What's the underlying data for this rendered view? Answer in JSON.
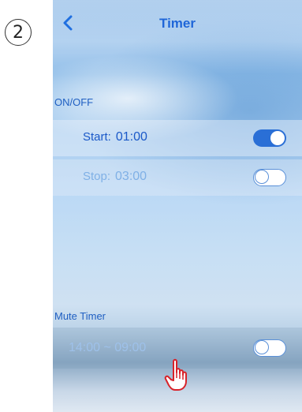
{
  "step_number": "2",
  "header": {
    "title": "Timer",
    "back_icon": "chevron-left-icon"
  },
  "onoff_section": {
    "label": "ON/OFF",
    "start": {
      "label": "Start:",
      "time": "01:00",
      "enabled": true
    },
    "stop": {
      "label": "Stop:",
      "time": "03:00",
      "enabled": false
    }
  },
  "mute_section": {
    "label": "Mute Timer",
    "range": "14:00 ~ 09:00",
    "enabled": false
  },
  "pointer": {
    "icon": "hand-pointer-icon"
  },
  "colors": {
    "accent": "#1f66d8",
    "toggle_on": "#2a6fd6",
    "pointer": "#d8232a"
  }
}
